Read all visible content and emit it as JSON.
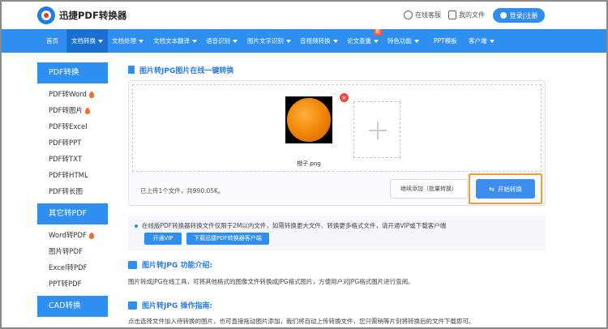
{
  "header": {
    "logo_text": "迅捷PDF转换器",
    "support_label": "在线客服",
    "my_files_label": "我的文件",
    "login_label": "登录|注册"
  },
  "nav": {
    "items": [
      {
        "label": "首页"
      },
      {
        "label": "文档转换"
      },
      {
        "label": "文档处理"
      },
      {
        "label": "文档文本翻译"
      },
      {
        "label": "语音识别"
      },
      {
        "label": "图片文字识别"
      },
      {
        "label": "音视频转换"
      },
      {
        "label": "论文查重"
      },
      {
        "label": "特色功能"
      },
      {
        "label": "PPT模板"
      },
      {
        "label": "客户端"
      }
    ],
    "new_badge": "新"
  },
  "sidebar": {
    "sections": [
      {
        "title": "PDF转换",
        "items": [
          "PDF转Word",
          "PDF转图片",
          "PDF转Excel",
          "PDF转PPT",
          "PDF转TXT",
          "PDF转HTML",
          "PDF转长图"
        ]
      },
      {
        "title": "其它转PDF",
        "items": [
          "Word转PDF",
          "图片转PDF",
          "Excel转PDF",
          "PPT转PDF"
        ]
      },
      {
        "title": "CAD转换",
        "items": []
      }
    ]
  },
  "main": {
    "page_title": "图片转JPG图片在线一键转换",
    "upload": {
      "file_name": "橙子.png",
      "status": "已上传1个文件，共990.05K。",
      "add_more_label": "继续添加（批量转换）",
      "start_label": "开始转换"
    },
    "notice": {
      "text": "在线版PDF转换器转换文件仅限于2M以内文件，如需转换更大文件、转换更多格式文件，请开通VIP或下载客户端",
      "vip_label": "开通VIP",
      "download_label": "下载迅捷PDF转换器客户端"
    },
    "intro": {
      "title": "图片转JPG 功能介绍:",
      "text": "图片转成JPG在线工具，可将其他格式的图像文件转换成JPG格式图片，方便用户对JPG格式图片进行查阅。"
    },
    "guide": {
      "title": "图片转JPG 操作指南:",
      "text": "点击选择文件加入待转换的图片，也可直接拖动图片添加，我们将自动上传转换文件，您只需稍等片刻将转换后的文件下载即可。"
    }
  },
  "colors": {
    "primary": "#2f8ff0",
    "active_nav": "#1a6fd0",
    "highlight": "#f39a3b"
  }
}
